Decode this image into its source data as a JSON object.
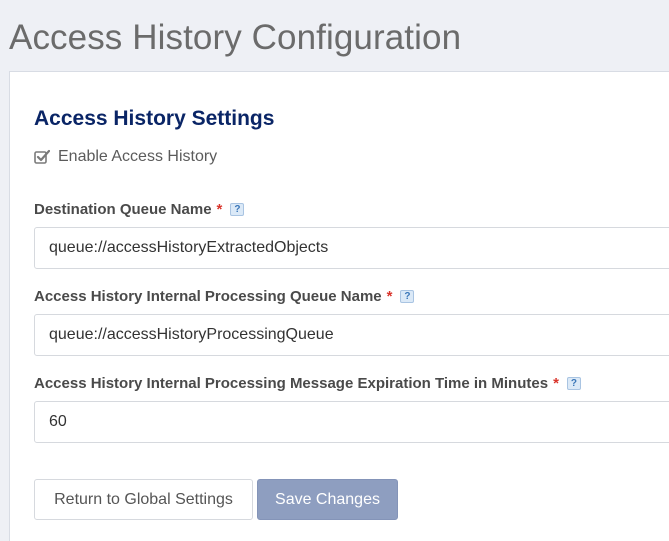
{
  "page": {
    "title": "Access History Configuration"
  },
  "section": {
    "title": "Access History Settings"
  },
  "enable_checkbox": {
    "label": "Enable Access History",
    "checked": true
  },
  "fields": [
    {
      "label": "Destination Queue Name",
      "required": "*",
      "help": "?",
      "value": "queue://accessHistoryExtractedObjects"
    },
    {
      "label": "Access History Internal Processing Queue Name",
      "required": "*",
      "help": "?",
      "value": "queue://accessHistoryProcessingQueue"
    },
    {
      "label": "Access History Internal Processing Message Expiration Time in Minutes",
      "required": "*",
      "help": "?",
      "value": "60"
    }
  ],
  "buttons": {
    "return_label": "Return to Global Settings",
    "save_label": "Save Changes"
  },
  "colors": {
    "section_title": "#0a2566",
    "required": "#d9342b",
    "primary_button": "#8e9ec0"
  }
}
